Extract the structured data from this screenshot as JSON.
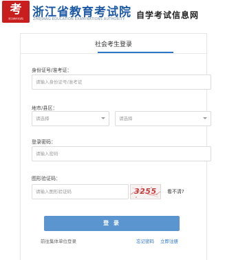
{
  "header": {
    "logo_glyph": "考",
    "logo_caption": "浙江省教育考试院",
    "org_name": "浙江省教育考试院",
    "org_name_en": "ZHEJIANG EDUCATION EXAMINATIONS AUTHORITY",
    "slogan": "自学考试信息网"
  },
  "panel": {
    "title": "社会考生登录"
  },
  "form": {
    "id_label": "身份证号/准考证：",
    "id_placeholder": "请输入身份证号/准考证",
    "region_label": "地市/县区：",
    "city_select": "请选择",
    "district_select": "请选择",
    "password_label": "登录密码：",
    "password_placeholder": "请输入密码",
    "captcha_label": "图形验证码：",
    "captcha_placeholder": "请输入图形验证码",
    "captcha_code": "3255",
    "captcha_refresh": "看不清?",
    "login_button": "登 录",
    "group_login_link": "前往集体单位登录",
    "forgot_password_link": "忘记密码",
    "register_link": "立即注册"
  },
  "colors": {
    "brand_red": "#c81e1e",
    "brand_blue": "#1f5aa6",
    "accent_blue": "#2b74c6",
    "button_blue": "#5b95d0"
  }
}
